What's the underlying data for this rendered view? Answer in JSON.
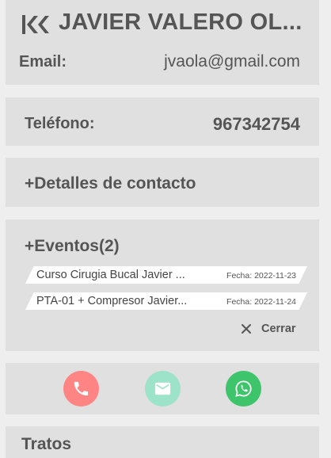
{
  "contact": {
    "name": "JAVIER VALERO OL...",
    "email_label": "Email:",
    "email": "jvaola@gmail.com",
    "phone_label": "Teléfono:",
    "phone": "967342754"
  },
  "details": {
    "title": "+Detalles de contacto"
  },
  "events": {
    "title": "+Eventos(2)",
    "items": [
      {
        "name": "Curso Cirugia Bucal Javier ...",
        "date": "Fecha: 2022-11-23"
      },
      {
        "name": "PTA-01 + Compresor Javier...",
        "date": "Fecha: 2022-11-24"
      }
    ],
    "close_label": "Cerrar"
  },
  "actions": {
    "call_icon": "phone-icon",
    "mail_icon": "mail-icon",
    "whatsapp_icon": "whatsapp-icon",
    "colors": {
      "call": "#ff8585",
      "mail": "#9de3c9",
      "whatsapp": "#3ec46a"
    }
  },
  "deals": {
    "title": "Tratos"
  }
}
